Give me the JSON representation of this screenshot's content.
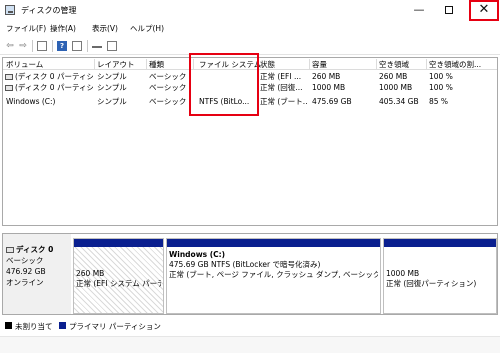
{
  "window": {
    "title": "ディスクの管理",
    "minimize_glyph": "—",
    "close_glyph": "✕"
  },
  "menu": [
    "ファイル(F)",
    "操作(A)",
    "表示(V)",
    "ヘルプ(H)"
  ],
  "toolbar": {
    "back_glyph": "⇦",
    "forward_glyph": "⇨",
    "help_glyph": "?"
  },
  "volume_table": {
    "headers": [
      "ボリューム",
      "レイアウト",
      "種類",
      "ファイル システム",
      "状態",
      "容量",
      "空き領域",
      "空き領域の割..."
    ],
    "rows": [
      [
        "(ディスク 0 パーティション 1)",
        "シンプル",
        "ベーシック",
        "",
        "正常 (EFI ...",
        "260 MB",
        "260 MB",
        "100 %"
      ],
      [
        "(ディスク 0 パーティション 4)",
        "シンプル",
        "ベーシック",
        "",
        "正常 (回復...",
        "1000 MB",
        "1000 MB",
        "100 %"
      ],
      [
        "Windows (C:)",
        "シンプル",
        "ベーシック",
        "NTFS (BitLo...",
        "正常 (ブート...",
        "475.69 GB",
        "405.34 GB",
        "85 %"
      ]
    ]
  },
  "disk": {
    "name": "ディスク 0",
    "type": "ベーシック",
    "size": "476.92 GB",
    "status": "オンライン",
    "partitions": [
      {
        "name": "",
        "line1": "260 MB",
        "line2": "正常 (EFI システム パーテ",
        "hatched": true
      },
      {
        "name": "Windows  (C:)",
        "line1": "475.69 GB NTFS (BitLocker で暗号化済み)",
        "line2": "正常 (ブート, ページ ファイル, クラッシュ ダンプ, ベーシック データ パ",
        "hatched": false
      },
      {
        "name": "",
        "line1": "1000 MB",
        "line2": "正常 (回復パーティション)",
        "hatched": false
      }
    ]
  },
  "legend": [
    {
      "label": "未割り当て",
      "color": "#000000"
    },
    {
      "label": "プライマリ パーティション",
      "color": "#0a1f8f"
    }
  ],
  "colors": {
    "highlight": "#e60012",
    "partition_bar": "#0a1f8f"
  }
}
